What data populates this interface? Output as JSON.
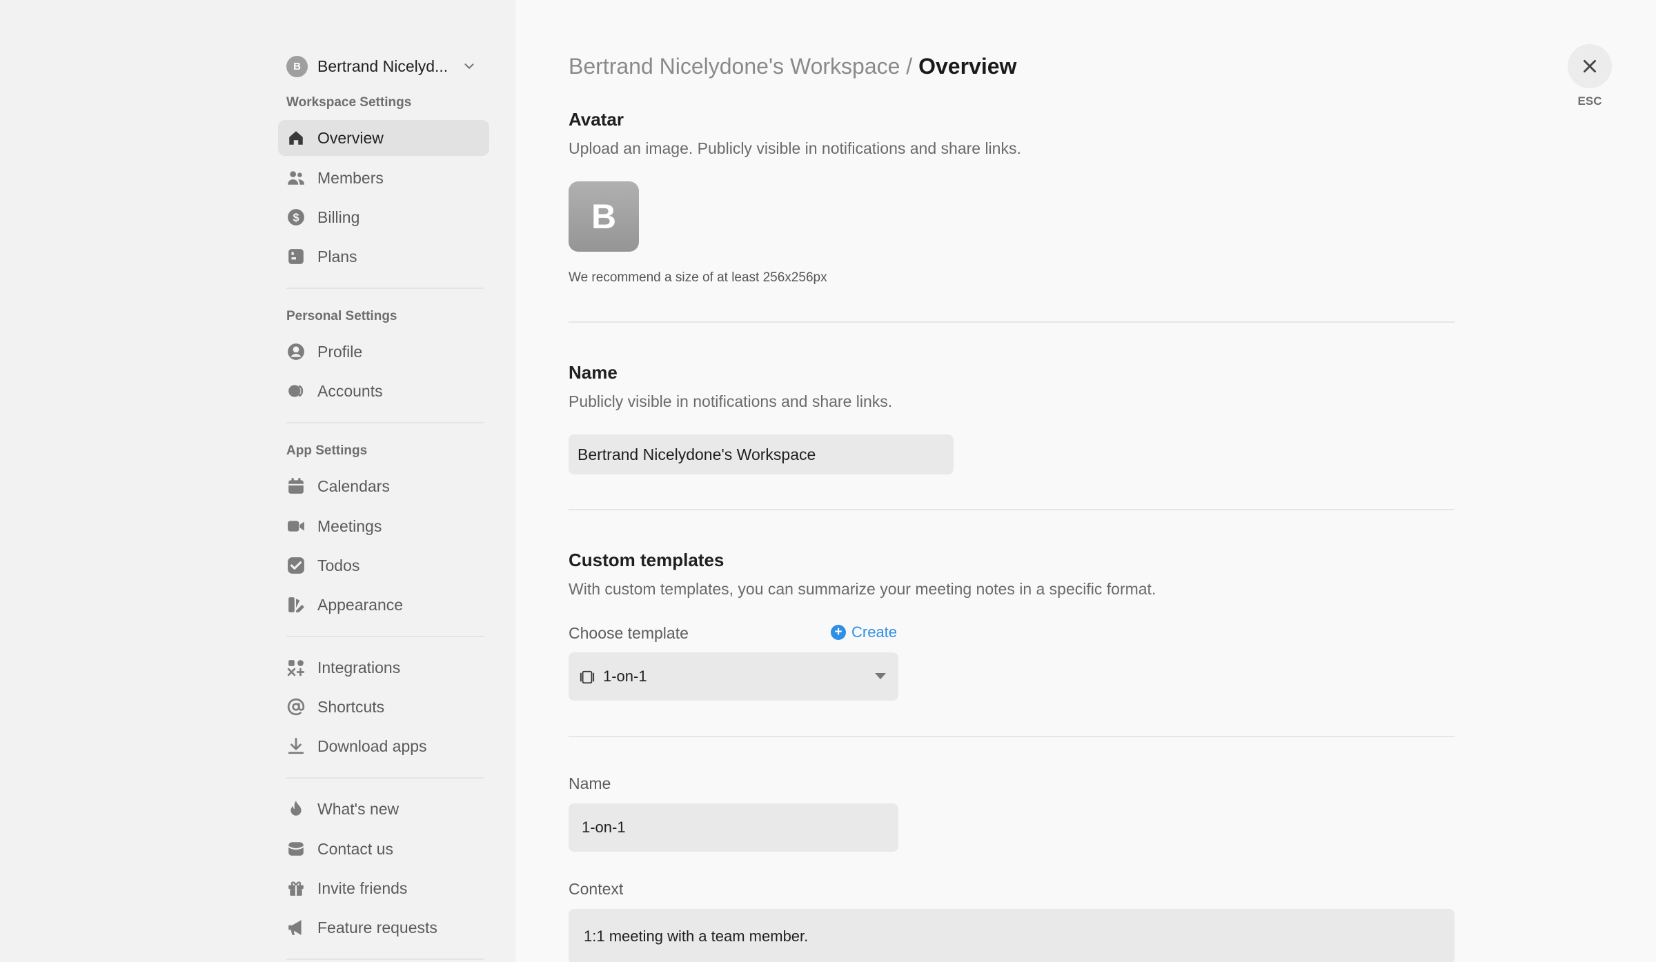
{
  "workspace": {
    "initial": "B",
    "name": "Bertrand Nicelyd..."
  },
  "sidebar": {
    "sections": {
      "workspace": "Workspace Settings",
      "personal": "Personal Settings",
      "app": "App Settings"
    },
    "items": [
      {
        "label": "Overview",
        "icon": "home-icon",
        "active": true
      },
      {
        "label": "Members",
        "icon": "users-icon"
      },
      {
        "label": "Billing",
        "icon": "dollar-icon"
      },
      {
        "label": "Plans",
        "icon": "plans-icon"
      },
      {
        "label": "Profile",
        "icon": "user-circle-icon"
      },
      {
        "label": "Accounts",
        "icon": "accounts-icon"
      },
      {
        "label": "Calendars",
        "icon": "calendar-icon"
      },
      {
        "label": "Meetings",
        "icon": "video-icon"
      },
      {
        "label": "Todos",
        "icon": "check-icon"
      },
      {
        "label": "Appearance",
        "icon": "palette-icon"
      },
      {
        "label": "Integrations",
        "icon": "integrations-icon"
      },
      {
        "label": "Shortcuts",
        "icon": "at-icon"
      },
      {
        "label": "Download apps",
        "icon": "download-icon"
      },
      {
        "label": "What's new",
        "icon": "flame-icon"
      },
      {
        "label": "Contact us",
        "icon": "inbox-icon"
      },
      {
        "label": "Invite friends",
        "icon": "gift-icon"
      },
      {
        "label": "Feature requests",
        "icon": "megaphone-icon"
      }
    ]
  },
  "header": {
    "workspace": "Bertrand Nicelydone's Workspace /",
    "current": "Overview"
  },
  "avatar": {
    "title": "Avatar",
    "desc": "Upload an image. Publicly visible in notifications and share links.",
    "initial": "B",
    "hint": "We recommend a size of at least 256x256px"
  },
  "name": {
    "title": "Name",
    "desc": "Publicly visible in notifications and share links.",
    "value": "Bertrand Nicelydone's Workspace"
  },
  "templates": {
    "title": "Custom templates",
    "desc": "With custom templates, you can summarize your meeting notes in a specific format.",
    "choose_label": "Choose template",
    "create_label": "Create",
    "selected": "1-on-1",
    "name_label": "Name",
    "name_value": "1-on-1",
    "context_label": "Context",
    "context_value": "1:1 meeting with a team member."
  },
  "close": {
    "esc_label": "ESC"
  },
  "colors": {
    "accent": "#2f8fe6",
    "sidebar_bg": "#f2f2f2",
    "main_bg": "#f9f9f9"
  }
}
